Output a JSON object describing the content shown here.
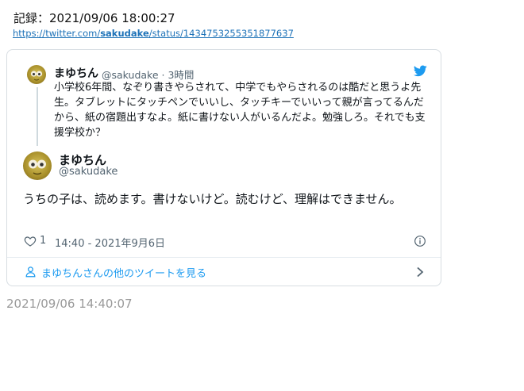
{
  "record": {
    "header": "記録：2021/09/06 18:00:27",
    "url_prefix": "https://twitter.com/",
    "url_user": "sakudake",
    "url_suffix": "/status/1434753255351877637"
  },
  "quoted_tweet": {
    "name": "まゆちん",
    "handle_time": "@sakudake · 3時間",
    "text": "小学校6年間、なぞり書きやらされて、中学でもやらされるのは酷だと思うよ先生。タブレットにタッチペンでいいし、タッチキーでいいって親が言ってるんだから、紙の宿題出すなよ。紙に書けない人がいるんだよ。勉強しろ。それでも支援学校か？"
  },
  "main_tweet": {
    "name": "まゆちん",
    "handle": "@sakudake",
    "text": "うちの子は、読めます。書けないけど。読むけど、理解はできません。",
    "like_count": "1",
    "timestamp": "14:40 - 2021年9月6日",
    "more_tweets": "まゆちんさんの他のツイートを見る"
  },
  "footer": {
    "time": "2021/09/06 14:40:07"
  },
  "colors": {
    "link": "#1d72b8",
    "twitter_blue": "#1d9bf0",
    "secondary_text": "#536471"
  },
  "icons": [
    "twitter-bird-icon",
    "heart-icon",
    "info-icon",
    "person-icon",
    "chevron-right-icon"
  ]
}
